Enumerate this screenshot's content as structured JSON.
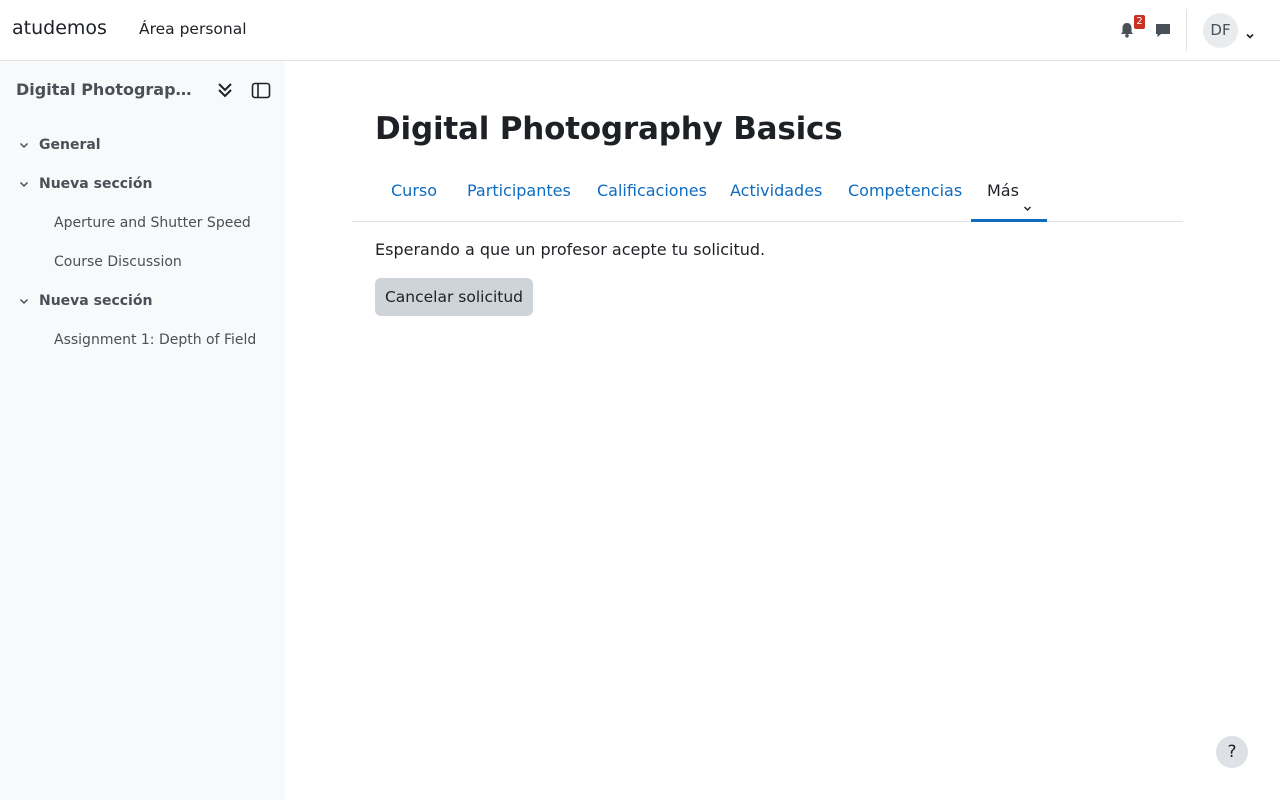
{
  "navbar": {
    "brand": "atudemos",
    "home_link": "Área personal",
    "notifications_count": "2",
    "user_initials": "DF"
  },
  "drawer": {
    "course_title": "Digital Photography Basics",
    "sections": [
      {
        "label": "General",
        "activities": []
      },
      {
        "label": "Nueva sección",
        "activities": [
          "Aperture and Shutter Speed",
          "Course Discussion"
        ]
      },
      {
        "label": "Nueva sección",
        "activities": [
          "Assignment 1: Depth of Field"
        ]
      }
    ]
  },
  "main": {
    "title": "Digital Photography Basics",
    "tabs": [
      "Curso",
      "Participantes",
      "Calificaciones",
      "Actividades",
      "Competencias",
      "Más"
    ],
    "message": "Esperando a que un profesor acepte tu solicitud.",
    "cancel_button": "Cancelar solicitud"
  },
  "help_label": "?",
  "colors": {
    "link": "#0f6cbf",
    "badge": "#ca3120",
    "drawer_bg": "#f8f9fa",
    "button_bg": "#ced4da"
  },
  "icons": {
    "notifications": "bell-icon",
    "messages": "chat-bubble-icon",
    "collapse_all": "double-chevron-down-icon",
    "close_drawer": "sidebar-panel-icon",
    "section_toggle": "chevron-down-icon"
  }
}
